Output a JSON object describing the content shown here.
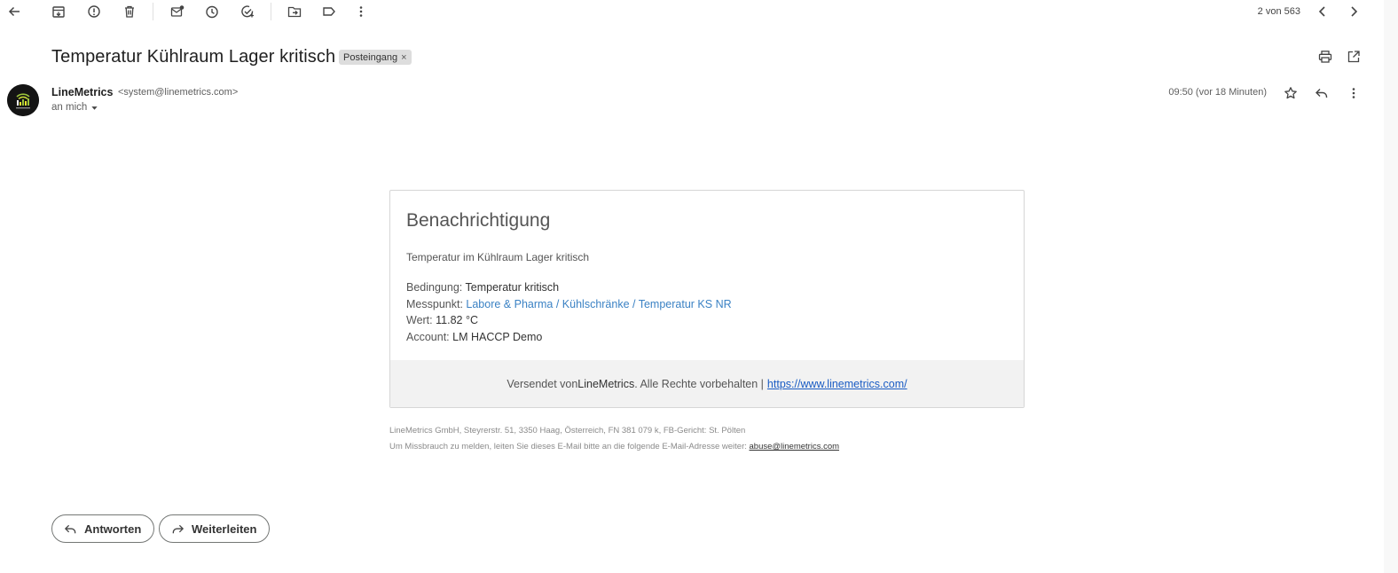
{
  "toolbar": {
    "icons": [
      "back-arrow-icon",
      "archive-icon",
      "report-spam-icon",
      "delete-icon",
      "mark-unread-icon",
      "snooze-icon",
      "add-task-icon",
      "move-to-icon",
      "label-icon",
      "more-vert-icon"
    ],
    "pager": "2 von 563"
  },
  "message": {
    "subject": "Temperatur Kühlraum Lager kritisch",
    "label": "Posteingang",
    "label_remove": "×",
    "sender_name": "LineMetrics",
    "sender_email": "<system@linemetrics.com>",
    "recipient": "an mich",
    "timestamp": "09:50 (vor 18 Minuten)"
  },
  "email": {
    "title": "Benachrichtigung",
    "intro": "Temperatur im Kühlraum Lager kritisch",
    "condition_label": "Bedingung:",
    "condition_value": "Temperatur kritisch",
    "point_label": "Messpunkt:",
    "point_value": "Labore & Pharma / Kühlschränke / Temperatur KS NR",
    "value_label": "Wert:",
    "value_value": "11.82 °C",
    "account_label": "Account:",
    "account_value": "LM HACCP Demo",
    "footer_prefix": "Versendet von",
    "footer_brand": "LineMetrics",
    "footer_suffix": ". Alle Rechte vorbehalten |",
    "footer_link": "https://www.linemetrics.com/",
    "legal_line1": "LineMetrics GmbH, Steyrerstr. 51, 3350 Haag, Österreich, FN 381 079 k, FB-Gericht: St. Pölten",
    "legal_line2": "Um Missbrauch zu melden, leiten Sie dieses E-Mail bitte an die folgende E-Mail-Adresse weiter:",
    "legal_email": "abuse@linemetrics.com"
  },
  "actions": {
    "reply": "Antworten",
    "forward": "Weiterleiten"
  },
  "colors": {
    "link": "#3b82c4",
    "footer_link": "#1a5cc4",
    "chip_bg": "#dddddd",
    "footer_bg": "#f2f2f2"
  }
}
